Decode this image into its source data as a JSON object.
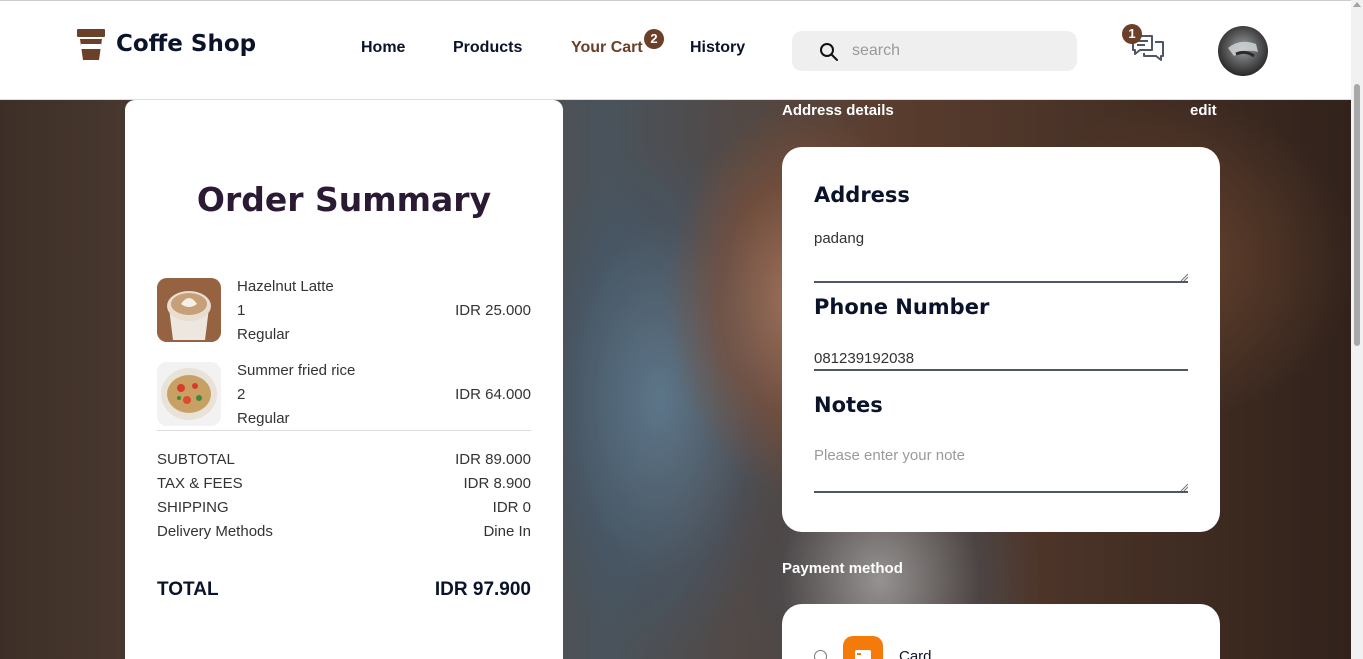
{
  "header": {
    "brand": "Coffe Shop",
    "nav": [
      {
        "label": "Home"
      },
      {
        "label": "Products"
      },
      {
        "label": "Your Cart",
        "badge": "2"
      },
      {
        "label": "History"
      }
    ],
    "search_placeholder": "search",
    "chat_badge": "1"
  },
  "summary": {
    "title": "Order Summary",
    "items": [
      {
        "name": "Hazelnut Latte",
        "qty": "1",
        "size": "Regular",
        "price": "IDR 25.000"
      },
      {
        "name": "Summer fried rice",
        "qty": "2",
        "size": "Regular",
        "price": "IDR 64.000"
      }
    ],
    "rows": [
      {
        "label": "SUBTOTAL",
        "value": "IDR 89.000"
      },
      {
        "label": "TAX & FEES",
        "value": "IDR 8.900"
      },
      {
        "label": "SHIPPING",
        "value": "IDR 0"
      },
      {
        "label": "Delivery Methods",
        "value": "Dine In"
      }
    ],
    "total_label": "TOTAL",
    "total_value": "IDR 97.900"
  },
  "address": {
    "section_label": "Address details",
    "edit_label": "edit",
    "address_title": "Address",
    "address_value": "padang",
    "phone_title": "Phone Number",
    "phone_value": "081239192038",
    "notes_title": "Notes",
    "notes_placeholder": "Please enter your note"
  },
  "payment": {
    "section_label": "Payment method",
    "options": [
      {
        "label": "Card",
        "icon": "card-icon",
        "color": "#f47b0a"
      }
    ]
  },
  "colors": {
    "brand": "#6a4029",
    "text_dark": "#0b132a"
  }
}
